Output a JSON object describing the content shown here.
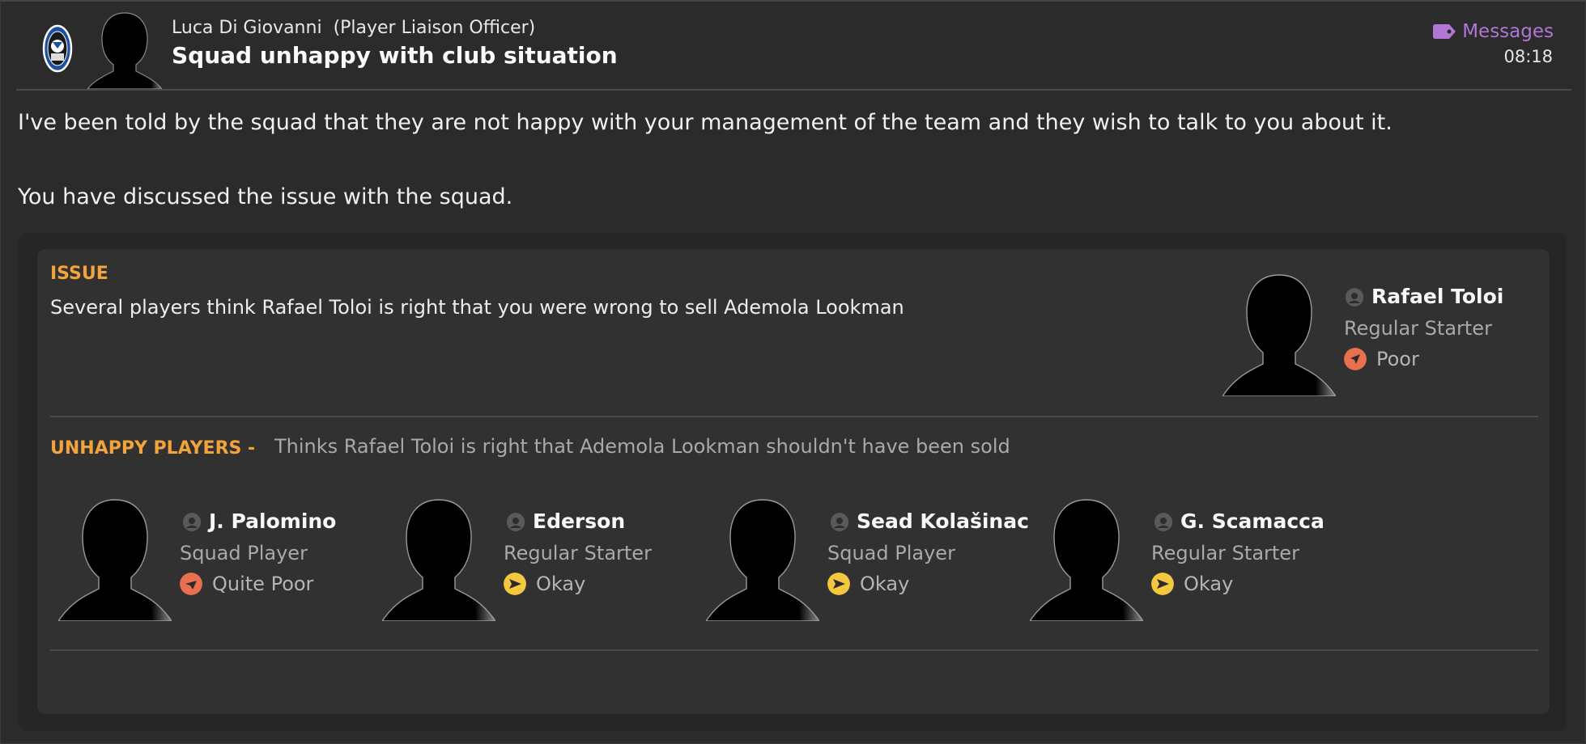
{
  "header": {
    "sender_name": "Luca Di Giovanni",
    "sender_role": "(Player Liaison Officer)",
    "subject": "Squad unhappy with club situation",
    "messages_label": "Messages",
    "time": "08:18"
  },
  "body": {
    "paragraph_1": "I've been told by the squad that they are not happy with your management of the team and they wish to talk to you about it.",
    "paragraph_2": "You have discussed the issue with the squad."
  },
  "issue": {
    "label": "ISSUE",
    "text": "Several players think Rafael Toloi is right that you were wrong to sell Ademola Lookman",
    "player": {
      "name": "Rafael Toloi",
      "role": "Regular Starter",
      "morale": "Poor"
    }
  },
  "unhappy": {
    "label": "UNHAPPY PLAYERS -",
    "description": "Thinks Rafael Toloi is right that Ademola Lookman shouldn't have been sold",
    "players": [
      {
        "name": "J. Palomino",
        "role": "Squad Player",
        "morale": "Quite Poor"
      },
      {
        "name": "Ederson",
        "role": "Regular Starter",
        "morale": "Okay"
      },
      {
        "name": "Sead Kolašinac",
        "role": "Squad Player",
        "morale": "Okay"
      },
      {
        "name": "G. Scamacca",
        "role": "Regular Starter",
        "morale": "Okay"
      }
    ]
  },
  "colors": {
    "background": "#2b2b2b",
    "accent_orange": "#f3a33b",
    "messages_purple": "#b176d6",
    "morale_poor": "#e8704f",
    "morale_okay": "#f4c83e"
  },
  "icons": {
    "messages": "tag-icon",
    "player_profile": "person-icon",
    "morale_poor": "down-arrow-morale-icon",
    "morale_okay": "right-arrow-morale-icon"
  }
}
